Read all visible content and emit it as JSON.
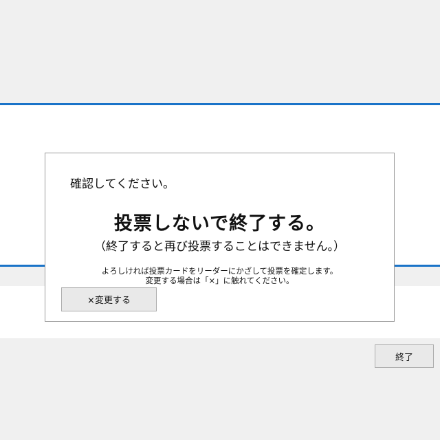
{
  "dialog": {
    "confirm_label": "確認してください。",
    "main_message": "投票しないで終了する。",
    "sub_message": "（終了すると再び投票することはできません。）",
    "instruction_line1": "よろしければ投票カードをリーダーにかざして投票を確定します。",
    "instruction_line2": "変更する場合は「×」に触れてください。",
    "change_button_label": "×変更する"
  },
  "footer": {
    "finish_button_label": "終了"
  },
  "colors": {
    "accent_line": "#1a73c8",
    "background": "#f0f0f0",
    "dialog_bg": "#ffffff",
    "button_bg": "#e9e9e9"
  }
}
